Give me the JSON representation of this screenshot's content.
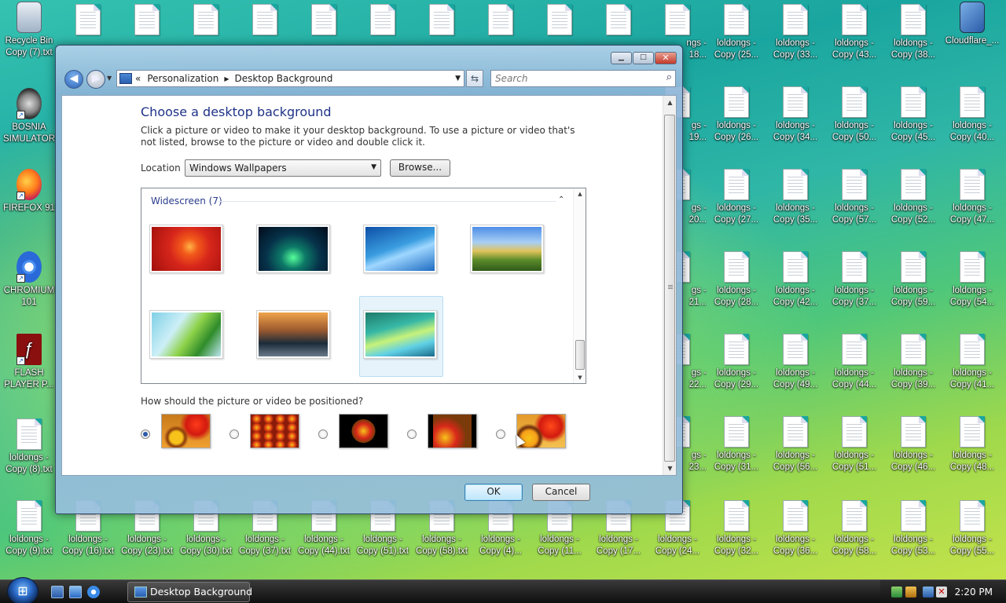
{
  "desktop": {
    "top_row": [
      {
        "l1": "Recycle Bin",
        "l2": "Copy (7).txt"
      },
      {
        "l1": "",
        "l2": ""
      },
      {
        "l1": "",
        "l2": ""
      },
      {
        "l1": "",
        "l2": ""
      },
      {
        "l1": "",
        "l2": ""
      },
      {
        "l1": "",
        "l2": ""
      },
      {
        "l1": "",
        "l2": ""
      },
      {
        "l1": "",
        "l2": ""
      },
      {
        "l1": "",
        "l2": ""
      },
      {
        "l1": "",
        "l2": ""
      },
      {
        "l1": "",
        "l2": ""
      },
      {
        "l1": "ngs -",
        "l2": "18..."
      },
      {
        "l1": "loldongs -",
        "l2": "Copy (25..."
      },
      {
        "l1": "loldongs -",
        "l2": "Copy (33..."
      },
      {
        "l1": "loldongs -",
        "l2": "Copy (43..."
      },
      {
        "l1": "loldongs -",
        "l2": "Copy (38..."
      },
      {
        "l1": "Cloudflare_...",
        "l2": ""
      }
    ],
    "left_col": [
      {
        "label": "BOSNIA SIMULATOR",
        "icon": "bosnia-simulator-icon"
      },
      {
        "label": "FIREFOX 91",
        "icon": "firefox-icon"
      },
      {
        "label": "CHROMIUM 101",
        "icon": "chromium-icon"
      },
      {
        "label": "FLASH PLAYER P...",
        "icon": "flash-player-icon"
      },
      {
        "label": "loldongs - Copy (8).txt",
        "icon": "text-file-icon"
      }
    ],
    "grid_rows": [
      [
        "gs -|19...",
        "loldongs -|Copy (26...",
        "loldongs -|Copy (34...",
        "loldongs -|Copy (50...",
        "loldongs -|Copy (45...",
        "loldongs -|Copy (40..."
      ],
      [
        "gs -|20...",
        "loldongs -|Copy (27...",
        "loldongs -|Copy (35...",
        "loldongs -|Copy (57...",
        "loldongs -|Copy (52...",
        "loldongs -|Copy (47..."
      ],
      [
        "gs -|21...",
        "loldongs -|Copy (28...",
        "loldongs -|Copy (42...",
        "loldongs -|Copy (37...",
        "loldongs -|Copy (59...",
        "loldongs -|Copy (54..."
      ],
      [
        "gs -|22...",
        "loldongs -|Copy (29...",
        "loldongs -|Copy (49...",
        "loldongs -|Copy (44...",
        "loldongs -|Copy (39...",
        "loldongs -|Copy (41..."
      ],
      [
        "gs -|23...",
        "loldongs -|Copy (31...",
        "loldongs -|Copy (56...",
        "loldongs -|Copy (51...",
        "loldongs -|Copy (46...",
        "loldongs -|Copy (48..."
      ]
    ],
    "bottom_row": [
      "loldongs -|Copy (9).txt",
      "loldongs -|Copy (16).txt",
      "loldongs -|Copy (23).txt",
      "loldongs -|Copy (30).txt",
      "loldongs -|Copy (37).txt",
      "loldongs -|Copy (44).txt",
      "loldongs -|Copy (51).txt",
      "loldongs -|Copy (58).txt",
      "loldongs -|Copy (4)...",
      "loldongs -|Copy (11...",
      "loldongs -|Copy (17...",
      "loldongs -|Copy (24...",
      "loldongs -|Copy (32...",
      "loldongs -|Copy (36...",
      "loldongs -|Copy (58...",
      "loldongs -|Copy (53...",
      "loldongs -|Copy (55..."
    ]
  },
  "window": {
    "title": "Desktop Background",
    "address": {
      "root": "«",
      "crumb1": "Personalization",
      "sep": "▶",
      "crumb2": "Desktop Background"
    },
    "search_placeholder": "Search",
    "heading": "Choose a desktop background",
    "description": "Click a picture or video to make it your desktop background. To use a picture or video that's not listed, browse to the picture or video and double click it.",
    "location_label": "Location",
    "location_value": "Windows Wallpapers",
    "browse_label": "Browse...",
    "group_label": "Widescreen (7)",
    "wallpapers": [
      "wallpaper-red-flower",
      "wallpaper-aurora",
      "wallpaper-fish",
      "wallpaper-hills",
      "wallpaper-palm-leaf",
      "wallpaper-mountain-lake",
      "wallpaper-vista-aurora"
    ],
    "selected_wallpaper": 6,
    "position_label": "How should the picture or video be positioned?",
    "position_options": [
      "fill",
      "tile",
      "center",
      "fit",
      "stretch"
    ],
    "selected_position": 0,
    "ok_label": "OK",
    "cancel_label": "Cancel"
  },
  "taskbar": {
    "task_label": "Desktop Background",
    "clock": "2:20 PM"
  },
  "colors": {
    "heading": "#1e3287",
    "group": "#2a3c8c",
    "selection": "#e6f3fb"
  }
}
